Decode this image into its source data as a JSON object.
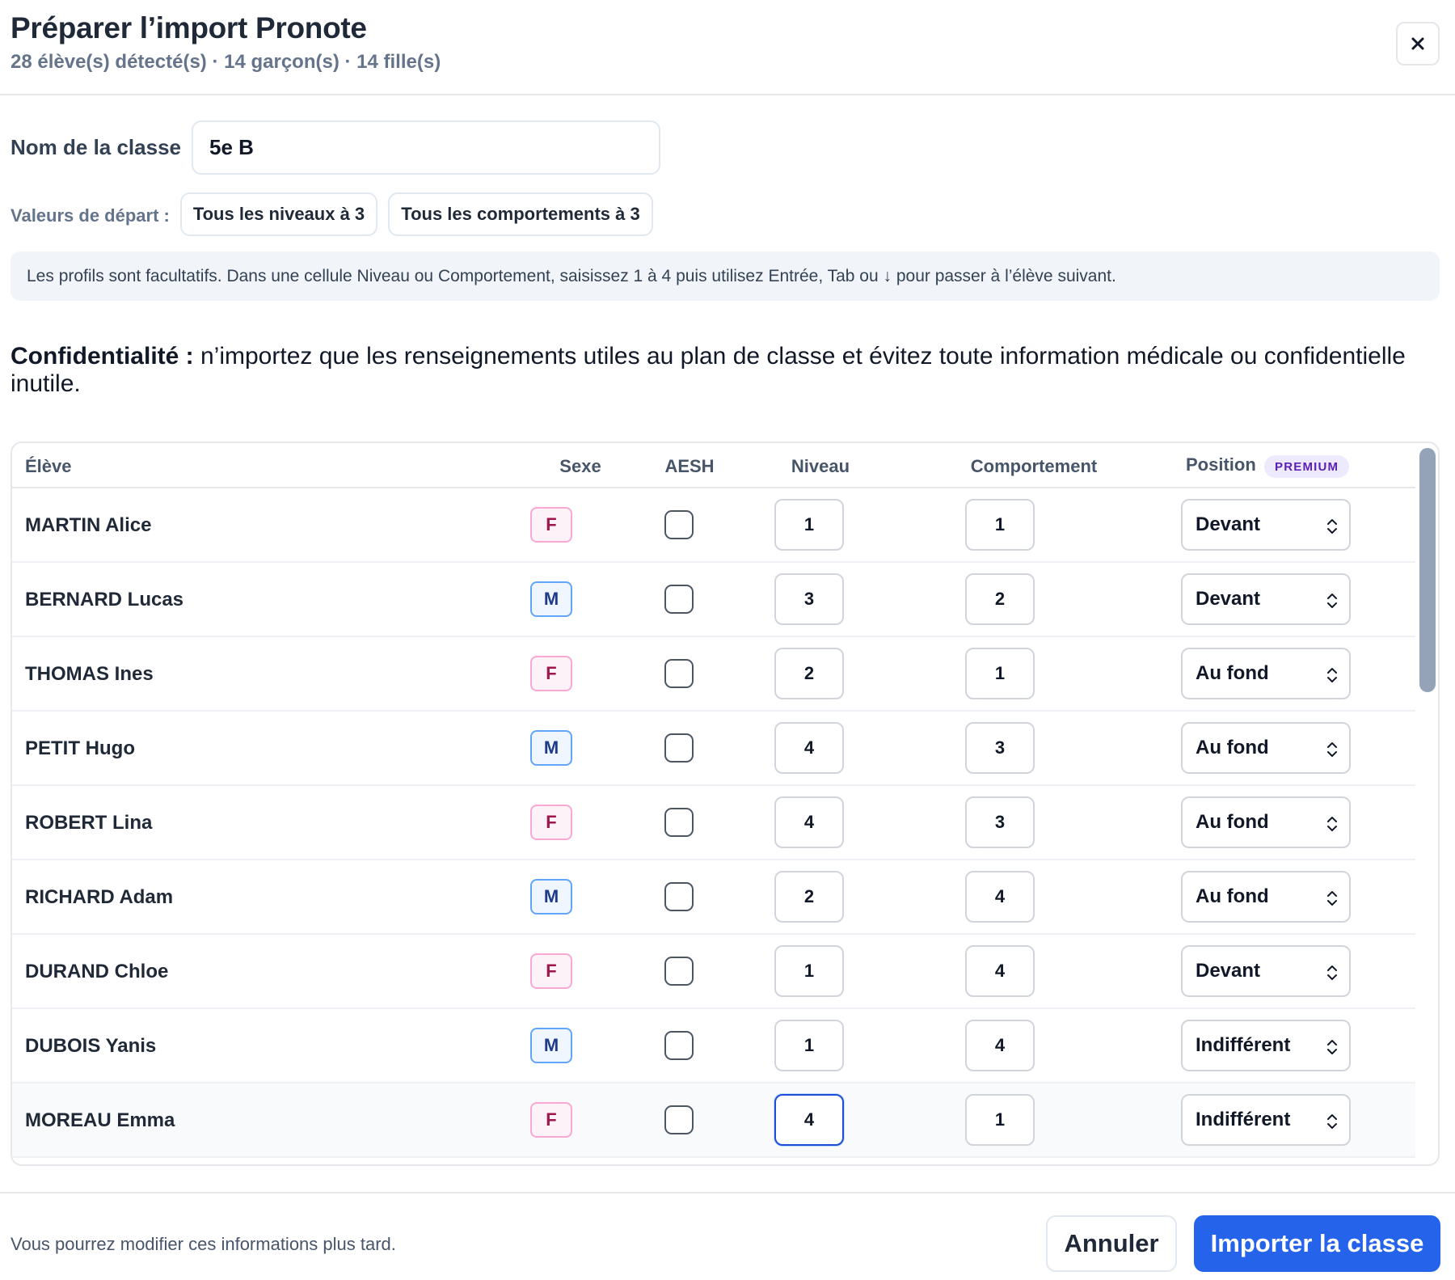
{
  "header": {
    "title": "Préparer l’import Pronote",
    "subtitle": "28 élève(s) détecté(s) · 14 garçon(s) · 14 fille(s)",
    "close_icon": "close-icon"
  },
  "class_name": {
    "label": "Nom de la classe",
    "value": "5e B"
  },
  "defaults": {
    "label": "Valeurs de départ :",
    "all_levels_button": "Tous les niveaux à 3",
    "all_behaviours_button": "Tous les comportements à 3"
  },
  "info_banner": "Les profils sont facultatifs. Dans une cellule Niveau ou Comportement, saisissez 1 à 4 puis utilisez Entrée, Tab ou ↓ pour passer à l’élève suivant.",
  "confidentiality": {
    "heading": "Confidentialité :",
    "text": " n’importez que les renseignements utiles au plan de classe et évitez toute information médicale ou confidentielle inutile."
  },
  "table": {
    "columns": {
      "eleve": "Élève",
      "sexe": "Sexe",
      "aesh": "AESH",
      "niveau": "Niveau",
      "comportement": "Comportement",
      "position": "Position",
      "premium_badge": "PREMIUM"
    },
    "rows": [
      {
        "name": "MARTIN Alice",
        "sex": "F",
        "aesh": false,
        "niveau": "1",
        "comportement": "1",
        "position": "Devant"
      },
      {
        "name": "BERNARD Lucas",
        "sex": "M",
        "aesh": false,
        "niveau": "3",
        "comportement": "2",
        "position": "Devant"
      },
      {
        "name": "THOMAS Ines",
        "sex": "F",
        "aesh": false,
        "niveau": "2",
        "comportement": "1",
        "position": "Au fond"
      },
      {
        "name": "PETIT Hugo",
        "sex": "M",
        "aesh": false,
        "niveau": "4",
        "comportement": "3",
        "position": "Au fond"
      },
      {
        "name": "ROBERT Lina",
        "sex": "F",
        "aesh": false,
        "niveau": "4",
        "comportement": "3",
        "position": "Au fond"
      },
      {
        "name": "RICHARD Adam",
        "sex": "M",
        "aesh": false,
        "niveau": "2",
        "comportement": "4",
        "position": "Au fond"
      },
      {
        "name": "DURAND Chloe",
        "sex": "F",
        "aesh": false,
        "niveau": "1",
        "comportement": "4",
        "position": "Devant"
      },
      {
        "name": "DUBOIS Yanis",
        "sex": "M",
        "aesh": false,
        "niveau": "1",
        "comportement": "4",
        "position": "Indifférent"
      },
      {
        "name": "MOREAU Emma",
        "sex": "F",
        "aesh": false,
        "niveau": "4",
        "comportement": "1",
        "position": "Indifférent",
        "highlighted": true,
        "niveau_focused": true
      }
    ]
  },
  "footer": {
    "note": "Vous pourrez modifier ces informations plus tard.",
    "cancel_button": "Annuler",
    "import_button": "Importer la classe"
  },
  "colors": {
    "primary": "#2563eb",
    "female_badge": "#fdf2f8",
    "male_badge": "#eff6ff",
    "premium_badge": "#ede9fe",
    "info_banner_bg": "#f1f5f9"
  }
}
